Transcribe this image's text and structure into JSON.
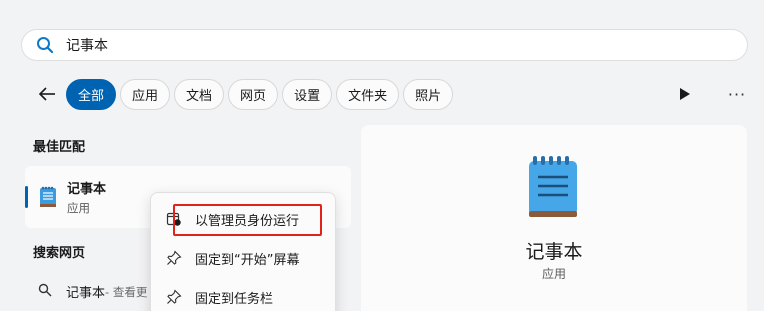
{
  "search": {
    "value": "记事本"
  },
  "filters": {
    "tabs": [
      {
        "label": "全部",
        "active": true
      },
      {
        "label": "应用"
      },
      {
        "label": "文档"
      },
      {
        "label": "网页"
      },
      {
        "label": "设置"
      },
      {
        "label": "文件夹"
      },
      {
        "label": "照片"
      }
    ],
    "more_label": "···"
  },
  "best_match": {
    "section_label": "最佳匹配",
    "name": "记事本",
    "type": "应用"
  },
  "web": {
    "section_label": "搜索网页",
    "query": "记事本",
    "suffix": " - 查看更"
  },
  "context_menu": {
    "items": [
      {
        "label": "以管理员身份运行",
        "icon": "admin-shield-icon"
      },
      {
        "label": "固定到“开始”屏幕",
        "icon": "pin-icon"
      },
      {
        "label": "固定到任务栏",
        "icon": "pin-icon"
      }
    ]
  },
  "detail": {
    "title": "记事本",
    "subtitle": "应用"
  },
  "colors": {
    "accent": "#0063b1",
    "highlight": "#e2231a",
    "search_icon": "#0a7ac9"
  }
}
